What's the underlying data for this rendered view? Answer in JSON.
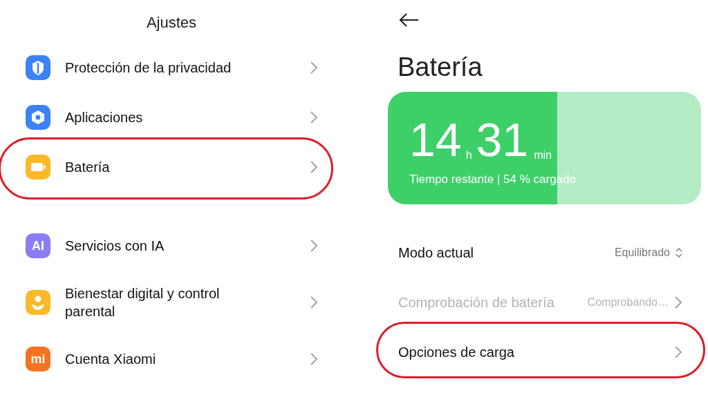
{
  "settings": {
    "title": "Ajustes",
    "groups": [
      {
        "items": [
          {
            "label": "Protección de la privacidad",
            "kind": "shield",
            "color": "#3b82f6",
            "highlighted": false
          },
          {
            "label": "Aplicaciones",
            "kind": "hexagon",
            "color": "#3b82f6",
            "highlighted": false
          },
          {
            "label": "Batería",
            "kind": "battery",
            "color": "#fbb829",
            "highlighted": true
          }
        ]
      },
      {
        "items": [
          {
            "label": "Servicios con IA",
            "kind": "text",
            "icon_text": "AI",
            "color": "#8b7cf6",
            "highlighted": false
          },
          {
            "label": "Bienestar digital y control parental",
            "kind": "person",
            "color": "#fbb829",
            "highlighted": false
          },
          {
            "label": "Cuenta Xiaomi",
            "kind": "text",
            "icon_text": "mi",
            "color": "#f47321",
            "highlighted": false
          }
        ]
      }
    ]
  },
  "battery": {
    "title": "Batería",
    "hours": "14",
    "hours_unit": "h",
    "minutes": "31",
    "minutes_unit": "min",
    "caption": "Tiempo restante | 54 % cargado",
    "level": 0.54,
    "rows": [
      {
        "label": "Modo actual",
        "value": "Equilibrado",
        "kind": "selector",
        "disabled": false,
        "highlighted": false
      },
      {
        "label": "Comprobación de batería",
        "value": "Comprobando…",
        "kind": "link",
        "disabled": true,
        "highlighted": false
      },
      {
        "label": "Opciones de carga",
        "kind": "link",
        "disabled": false,
        "highlighted": true
      }
    ]
  }
}
